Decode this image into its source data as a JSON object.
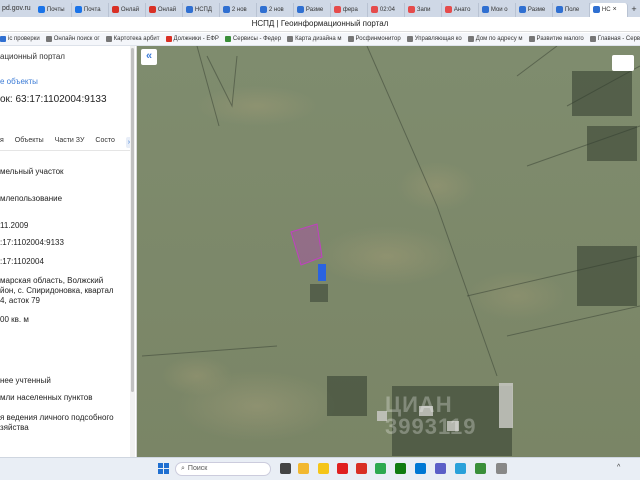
{
  "browser": {
    "url_fragment": "pd.gov.ru",
    "window_title": "НСПД | Геоинформационный портал",
    "tabs": [
      {
        "label": "Почты",
        "color": "#1a73e8"
      },
      {
        "label": "Почта",
        "color": "#1a73e8"
      },
      {
        "label": "Онлай",
        "color": "#d93025"
      },
      {
        "label": "Онлай",
        "color": "#d93025"
      },
      {
        "label": "НСПД",
        "color": "#2f6fd1"
      },
      {
        "label": "2 нов",
        "color": "#2f6fd1"
      },
      {
        "label": "2 нов",
        "color": "#2f6fd1"
      },
      {
        "label": "Разме",
        "color": "#2f6fd1"
      },
      {
        "label": "фера",
        "color": "#e54b4b"
      },
      {
        "label": "02:04",
        "color": "#e54b4b"
      },
      {
        "label": "Запи",
        "color": "#e54b4b"
      },
      {
        "label": "Анато",
        "color": "#e54b4b"
      },
      {
        "label": "Мои о",
        "color": "#2f6fd1"
      },
      {
        "label": "Разме",
        "color": "#2f6fd1"
      },
      {
        "label": "Поле",
        "color": "#2f6fd1"
      },
      {
        "label": "НС",
        "color": "#2f6fd1",
        "active": true
      }
    ],
    "new_tab": "+",
    "bookmarks": [
      {
        "label": "іс проверки",
        "color": "#2f6fd1"
      },
      {
        "label": "Онлайн поиск ог",
        "color": "#777"
      },
      {
        "label": "Картотека арбит",
        "color": "#777"
      },
      {
        "label": "Должники - ЕФР",
        "color": "#d93025"
      },
      {
        "label": "Сервисы - Федер",
        "color": "#3a8f3a"
      },
      {
        "label": "Карта дизайна м",
        "color": "#777"
      },
      {
        "label": "Росфинмонитор",
        "color": "#777"
      },
      {
        "label": "Управляющая ко",
        "color": "#777"
      },
      {
        "label": "Дом по адресу м",
        "color": "#777"
      },
      {
        "label": "Развитие малого",
        "color": "#777"
      },
      {
        "label": "Главная - Серви",
        "color": "#777"
      }
    ]
  },
  "panel": {
    "title": "ационный портал",
    "nearby_link": "е объекты",
    "cadastral": "ок: 63:17:1102004:9133",
    "tabs": [
      "я",
      "Объекты",
      "Части ЗУ",
      "Состо"
    ],
    "tab_scroll_right": "›",
    "values": {
      "type": "мельный участок",
      "kind": "млепользование",
      "date": "11.2009",
      "number": ":17:1102004:9133",
      "quarter": ":17:1102004",
      "address": "марская область, Волжский йон, с. Спиридоновка, квартал 4, асток 79",
      "area": "00 кв. м",
      "status": "нее учтенный",
      "category": "мли населенных пунктов",
      "use": "я ведения личного подсобного зяйства"
    }
  },
  "map": {
    "collapse_label": "«",
    "watermark": "ЦИАН\n3993119"
  },
  "taskbar": {
    "search_placeholder": "Поиск",
    "search_icon": "search-icon",
    "tray_chevron": "^"
  }
}
